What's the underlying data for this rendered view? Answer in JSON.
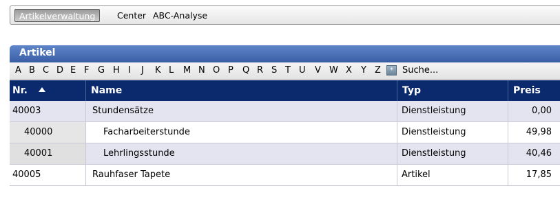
{
  "nav": {
    "items": [
      "Artikelverwaltung",
      "Center",
      "ABC-Analyse"
    ],
    "active": "Artikelverwaltung"
  },
  "panel": {
    "title": "Artikel"
  },
  "alphabet": {
    "letters": [
      "A",
      "B",
      "C",
      "D",
      "E",
      "F",
      "G",
      "H",
      "I",
      "J",
      "K",
      "L",
      "M",
      "N",
      "O",
      "P",
      "Q",
      "R",
      "S",
      "T",
      "U",
      "V",
      "W",
      "X",
      "Y",
      "Z"
    ],
    "all_button": "*",
    "search_label": "Suche..."
  },
  "table": {
    "columns": [
      {
        "label": "Nr.",
        "sorted": "ascending"
      },
      {
        "label": "Name"
      },
      {
        "label": "Typ"
      },
      {
        "label": "Preis"
      }
    ],
    "rows": [
      {
        "nr": "40003",
        "name": "Stundensätze",
        "typ": "Dienstleistung",
        "preis": "0,00",
        "child": false
      },
      {
        "nr": "40000",
        "name": "Facharbeiterstunde",
        "typ": "Dienstleistung",
        "preis": "49,98",
        "child": true
      },
      {
        "nr": "40001",
        "name": "Lehrlingsstunde",
        "typ": "Dienstleistung",
        "preis": "40,46",
        "child": true
      },
      {
        "nr": "40005",
        "name": "Rauhfaser Tapete",
        "typ": "Artikel",
        "preis": "17,85",
        "child": false
      }
    ]
  },
  "colors": {
    "header_bg": "#0b2a6e",
    "panel_header": "#3a5ea6",
    "row_alt": "#e4e4f0"
  }
}
